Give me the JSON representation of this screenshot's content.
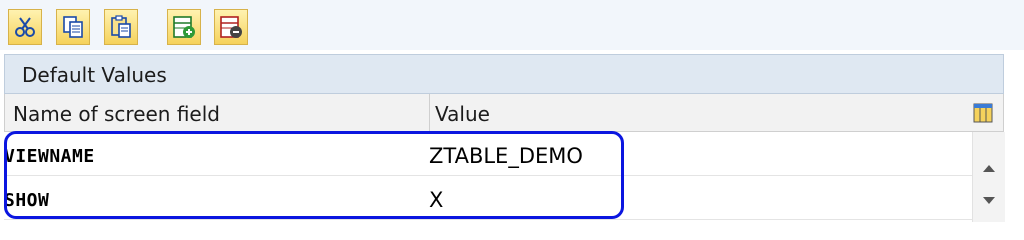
{
  "toolbar": {
    "buttons": [
      {
        "icon": "scissors-icon"
      },
      {
        "icon": "copy-icon"
      },
      {
        "icon": "paste-icon"
      },
      {
        "icon": "insert-row-icon"
      },
      {
        "icon": "delete-row-icon"
      }
    ]
  },
  "panel": {
    "title": "Default Values"
  },
  "grid": {
    "columns": [
      "Name of screen field",
      "Value"
    ],
    "rows": [
      {
        "name": "VIEWNAME",
        "value": "ZTABLE_DEMO"
      },
      {
        "name": "SHOW",
        "value": "X"
      }
    ],
    "settings_icon": "column-settings-icon"
  },
  "colors": {
    "toolbar_button_fill": "#f5d25c",
    "header_bg": "#dfe8f2",
    "highlight_border": "#0b16e0"
  }
}
